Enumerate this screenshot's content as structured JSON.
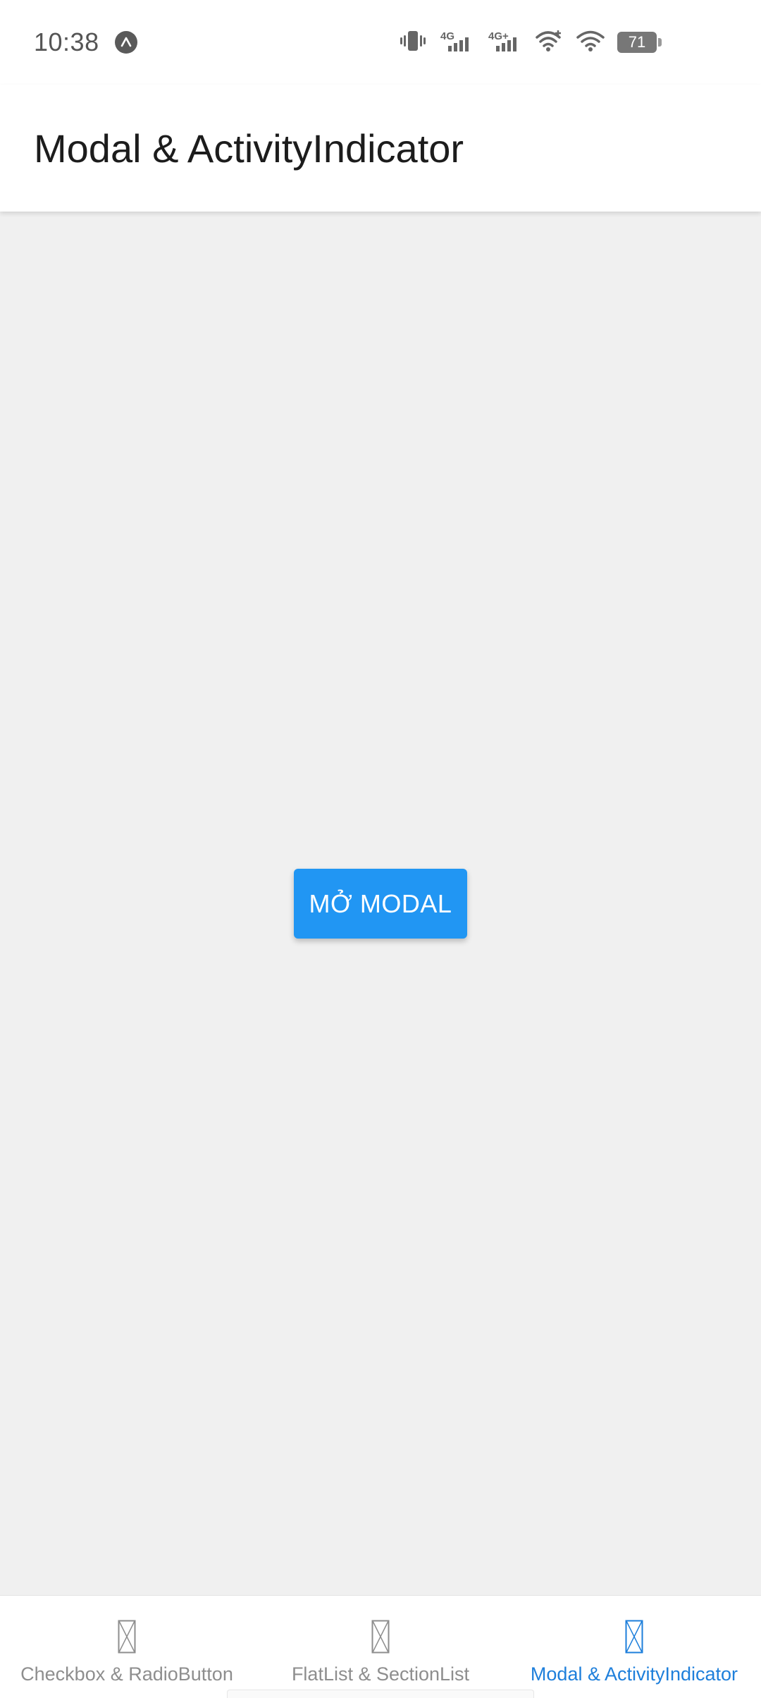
{
  "status_bar": {
    "time": "10:38",
    "app_icon": "expo-a-icon",
    "icons": [
      "vibrate-icon",
      "signal-4g-icon",
      "signal-4g-plus-icon",
      "wifi-plus-icon",
      "wifi-icon",
      "battery-icon"
    ],
    "network_1": "4G",
    "network_2": "4G+",
    "battery_level": "71"
  },
  "header": {
    "title": "Modal & ActivityIndicator"
  },
  "main": {
    "open_modal_label": "MỞ MODAL"
  },
  "tabs": [
    {
      "label": "Checkbox & RadioButton",
      "icon": "missing-glyph-icon",
      "active": false
    },
    {
      "label": "FlatList & SectionList",
      "icon": "missing-glyph-icon",
      "active": false
    },
    {
      "label": "Modal & ActivityIndicator",
      "icon": "missing-glyph-icon",
      "active": true
    }
  ],
  "colors": {
    "primary": "#2196f3",
    "active_tab": "#1e7fdb",
    "inactive_tab": "#8e8e8e",
    "background": "#f0f0f0",
    "header": "#ffffff"
  }
}
